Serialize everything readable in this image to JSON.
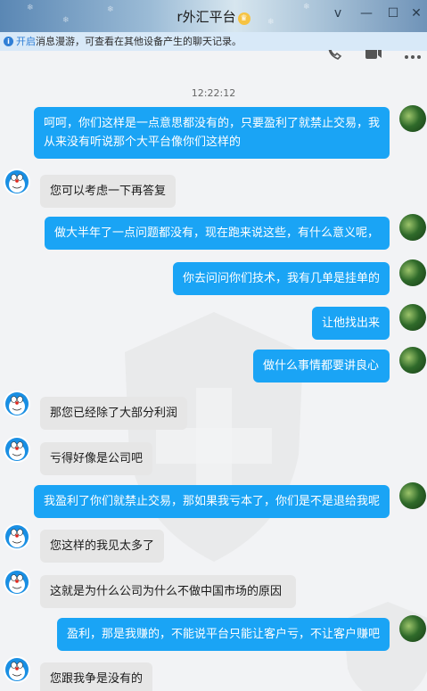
{
  "window": {
    "title": "r外汇平台",
    "controls": [
      "v",
      "—",
      "☐",
      "✕"
    ]
  },
  "notice": {
    "highlight": "开启",
    "text": "消息漫游，可查看在其他设备产生的聊天记录。"
  },
  "timestamp": "12:22:12",
  "messages": [
    {
      "from": "me",
      "lines": [
        "呵呵，你们这样是一点意思都没有的，只要盈利了就禁止交易，我",
        "从来没有听说那个大平台像你们这样的"
      ]
    },
    {
      "from": "them",
      "lines": [
        "您可以考虑一下再答复"
      ]
    },
    {
      "from": "me",
      "lines": [
        "做大半年了一点问题都没有，现在跑来说这些，有什么意义呢，"
      ]
    },
    {
      "from": "me",
      "lines": [
        "你去问问你们技术，我有几单是挂单的"
      ]
    },
    {
      "from": "me",
      "lines": [
        "让他找出来"
      ]
    },
    {
      "from": "me",
      "lines": [
        "做什么事情都要讲良心"
      ]
    },
    {
      "from": "them",
      "lines": [
        "那您已经除了大部分利润"
      ]
    },
    {
      "from": "them",
      "lines": [
        "亏得好像是公司吧"
      ]
    },
    {
      "from": "me",
      "lines": [
        "我盈利了你们就禁止交易，那如果我亏本了，你们是不是退给我呢"
      ]
    },
    {
      "from": "them",
      "lines": [
        "您这样的我见太多了"
      ]
    },
    {
      "from": "them",
      "lines": [
        "这就是为什么公司为什么不做中国市场的原因"
      ]
    },
    {
      "from": "me",
      "lines": [
        "盈利，那是我赚的，不能说平台只能让客户亏，不让客户赚吧"
      ]
    },
    {
      "from": "them",
      "lines": [
        "您跟我争是没有的"
      ]
    }
  ]
}
